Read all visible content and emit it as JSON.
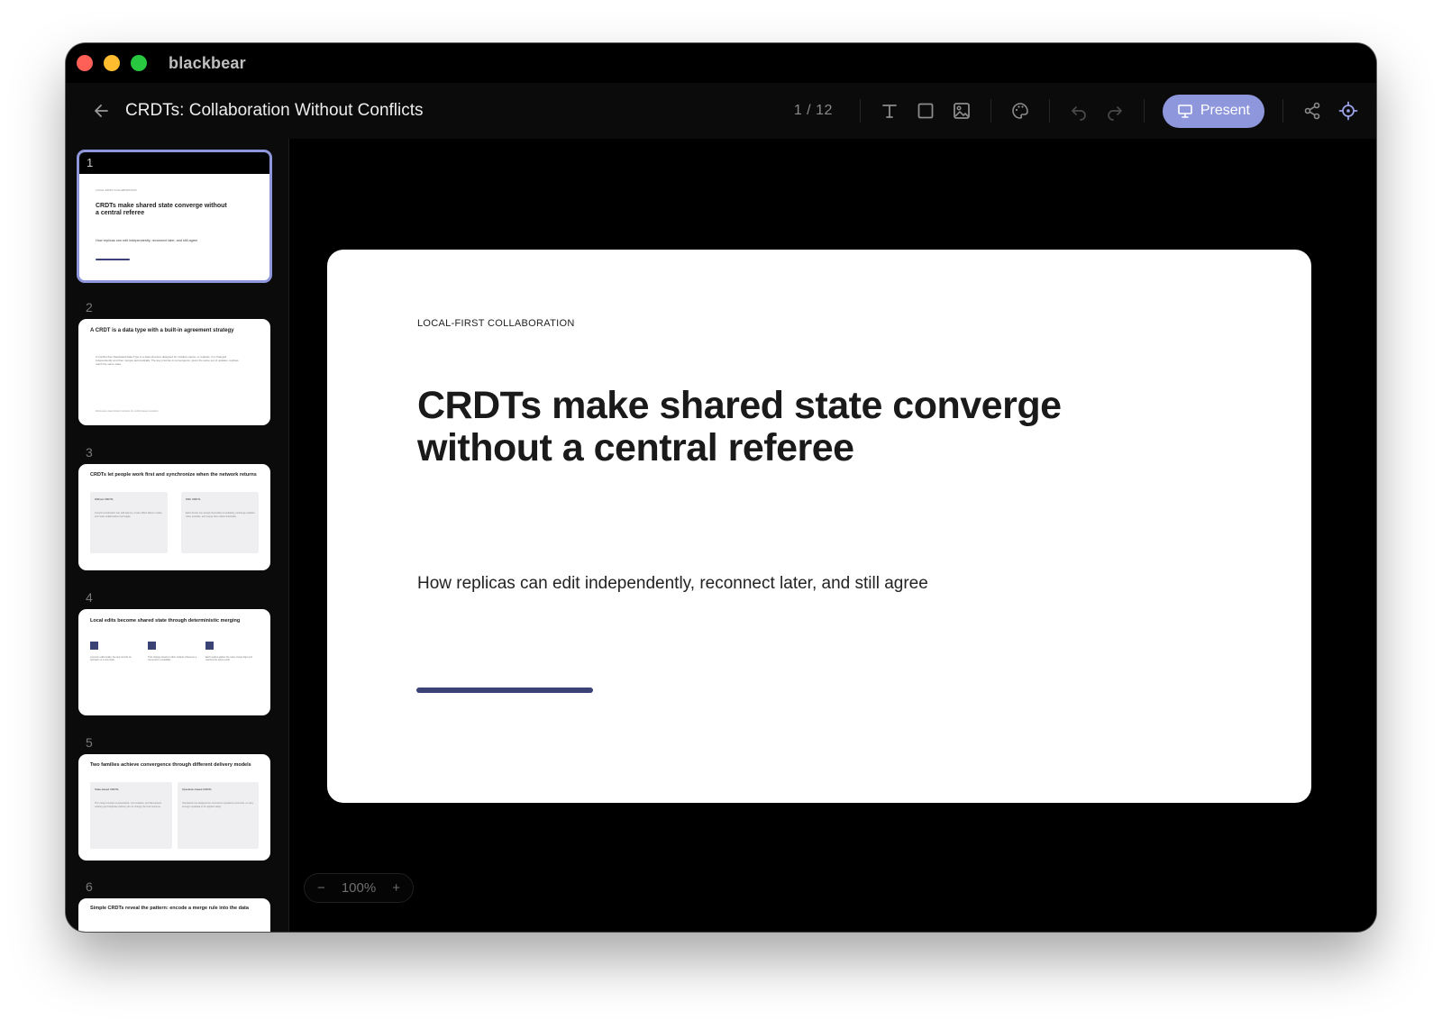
{
  "window": {
    "app_name": "blackbear"
  },
  "toolbar": {
    "doc_title": "CRDTs: Collaboration Without Conflicts",
    "page_counter": "1 / 12",
    "present_label": "Present"
  },
  "thumbnails": [
    {
      "number": "1",
      "kicker": "LOCAL-FIRST COLLABORATION",
      "title": "CRDTs make shared state converge without a central referee",
      "subtitle": "How replicas can edit independently, reconnect later, and still agree"
    },
    {
      "number": "2",
      "title": "A CRDT is a data type with a built-in agreement strategy",
      "body": "A Conflict-free Replicated Data Type is a data structure designed for multiple copies, or replicas. It is changed independently and then merges automatically. The key promise is convergence: given the same set of updates, replicas reach the same state.",
      "footer": "Well-known deterministic functions for conflict-based resolution"
    },
    {
      "number": "3",
      "title": "CRDTs let people work first and synchronize when the network returns",
      "left_label": "Without CRDTs",
      "left_text": "Central coordination can add latency, create offline failure modes, and make collaboration feel fragile.",
      "right_label": "With CRDTs",
      "right_text": "Each device can accept local edits immediately, exchange updates when possible, and merge them deterministically."
    },
    {
      "number": "4",
      "title": "Local edits become shared state through deterministic merging",
      "col1": "A person edits locally; the app records an operation or a new state.",
      "col2": "That change travels to other replicas whenever a connection is available.",
      "col3": "Each replica applies the same merge logic and reaches the same result."
    },
    {
      "number": "5",
      "title": "Two families achieve convergence through different delivery models",
      "left_label": "State-based CRDTs",
      "left_text": "The merge function is associative, commutative, and idempotent, ordering and duplicate delivery do not change the final outcome.",
      "right_label": "Operation-based CRDTs",
      "right_text": "Operations are designed so concurrent operations commute, or carry enough metadata to be applied safely."
    },
    {
      "number": "6",
      "title": "Simple CRDTs reveal the pattern: encode a merge rule into the data"
    }
  ],
  "slide": {
    "kicker": "LOCAL-FIRST COLLABORATION",
    "headline": "CRDTs make shared state converge without a central referee",
    "subhead": "How replicas can edit independently, reconnect later, and still agree"
  },
  "zoom": {
    "minus": "−",
    "level": "100%",
    "plus": "+"
  },
  "colors": {
    "accent": "#8e96dc",
    "slide_accent": "#3a4276",
    "background": "#000000"
  }
}
